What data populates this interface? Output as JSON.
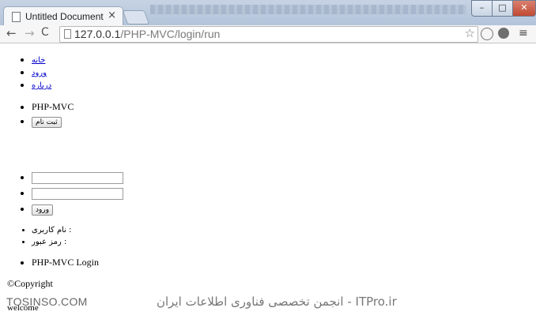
{
  "browser": {
    "tab_title": "Untitled Document",
    "tab_close": "×",
    "url_host": "127.0.0.1",
    "url_path": "/PHP-MVC/login/run",
    "window_controls": {
      "minimize": "–",
      "maximize": "□",
      "close": "✕"
    },
    "nav": {
      "back": "←",
      "forward": "→",
      "reload": "C"
    },
    "star": "☆",
    "menu": "≡"
  },
  "page": {
    "menu": [
      {
        "label": "خانه"
      },
      {
        "label": "ورود"
      },
      {
        "label": "درباره"
      }
    ],
    "brand": "PHP-MVC",
    "register_button": "ثبت نام",
    "username_value": "",
    "password_value": "",
    "login_button": "ورود",
    "username_label": "نام کاربری :",
    "password_label": "رمز عبور :",
    "login_title": "PHP-MVC Login",
    "copyright": "©Copyright",
    "welcome": "welcome"
  },
  "watermark": {
    "left": "TOSINSO.COM",
    "right": "ITPro.ir - انجمن تخصصی فناوری اطلاعات ایران"
  }
}
